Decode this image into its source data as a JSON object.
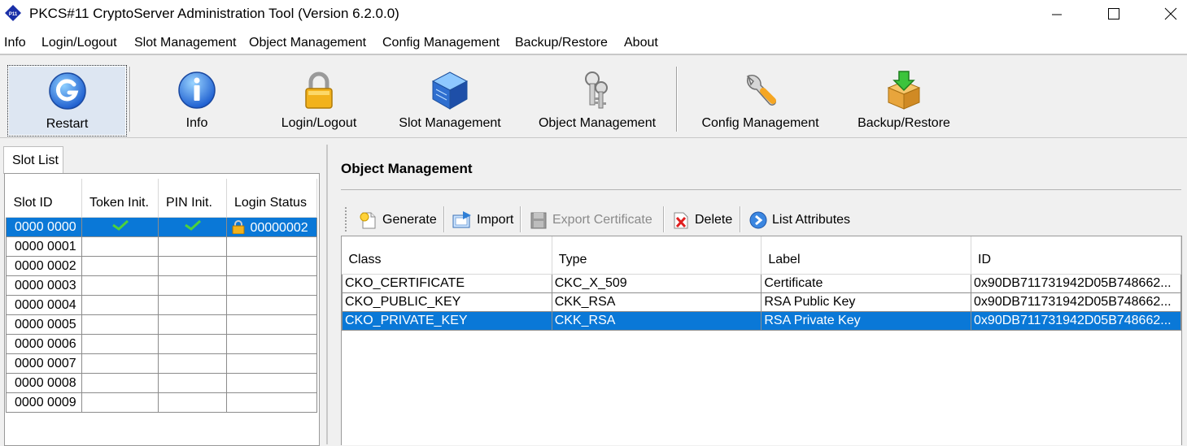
{
  "window": {
    "title": "PKCS#11 CryptoServer Administration Tool (Version 6.2.0.0)",
    "app_icon_text": "P11"
  },
  "menu": [
    "Info",
    "Login/Logout",
    "Slot Management",
    "Object Management",
    "Config Management",
    "Backup/Restore",
    "About"
  ],
  "toolbar": [
    {
      "label": "Restart",
      "icon": "restart-icon",
      "active": true
    },
    {
      "label": "Info",
      "icon": "info-icon"
    },
    {
      "label": "Login/Logout",
      "icon": "lock-icon"
    },
    {
      "label": "Slot Management",
      "icon": "slot-cube-icon"
    },
    {
      "label": "Object Management",
      "icon": "keys-icon"
    },
    {
      "label": "Config Management",
      "icon": "wrench-icon"
    },
    {
      "label": "Backup/Restore",
      "icon": "backup-box-icon"
    }
  ],
  "slot_panel": {
    "tab": "Slot List",
    "columns": [
      "Slot ID",
      "Token Init.",
      "PIN Init.",
      "Login Status"
    ],
    "rows": [
      {
        "slot_id": "0000 0000",
        "token_init": true,
        "pin_init": true,
        "login_status": "00000002",
        "selected": true
      },
      {
        "slot_id": "0000 0001"
      },
      {
        "slot_id": "0000 0002"
      },
      {
        "slot_id": "0000 0003"
      },
      {
        "slot_id": "0000 0004"
      },
      {
        "slot_id": "0000 0005"
      },
      {
        "slot_id": "0000 0006"
      },
      {
        "slot_id": "0000 0007"
      },
      {
        "slot_id": "0000 0008"
      },
      {
        "slot_id": "0000 0009"
      }
    ]
  },
  "object_panel": {
    "title": "Object Management",
    "actions": [
      {
        "label": "Generate",
        "icon": "generate-icon"
      },
      {
        "label": "Import",
        "icon": "import-icon"
      },
      {
        "label": "Export Certificate",
        "icon": "export-icon",
        "disabled": true
      },
      {
        "label": "Delete",
        "icon": "delete-icon"
      },
      {
        "label": "List Attributes",
        "icon": "list-attributes-icon"
      }
    ],
    "columns": [
      "Class",
      "Type",
      "Label",
      "ID"
    ],
    "rows": [
      {
        "class": "CKO_CERTIFICATE",
        "type": "CKC_X_509",
        "label": "Certificate",
        "id": "0x90DB711731942D05B748662..."
      },
      {
        "class": "CKO_PUBLIC_KEY",
        "type": "CKK_RSA",
        "label": "RSA Public Key",
        "id": "0x90DB711731942D05B748662..."
      },
      {
        "class": "CKO_PRIVATE_KEY",
        "type": "CKK_RSA",
        "label": "RSA Private Key",
        "id": "0x90DB711731942D05B748662...",
        "selected": true
      }
    ]
  },
  "colors": {
    "selection": "#0a78d7",
    "check": "#2f9e1e"
  }
}
